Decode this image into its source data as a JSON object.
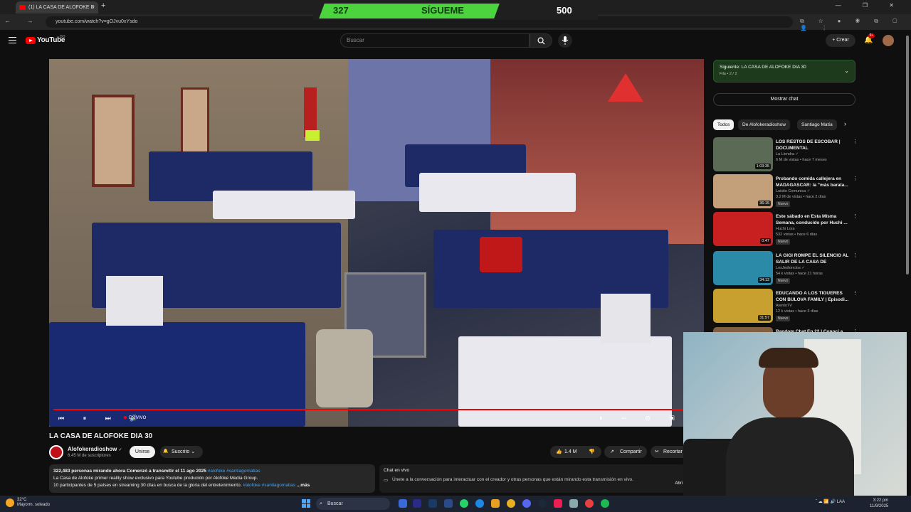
{
  "browser": {
    "tab_title": "(1) LA CASA DE ALOFOKE D",
    "url": "youtube.com/watch?v=gOJvu0xYsdo",
    "new_tab": "+",
    "window_controls": "— ❐ ✕",
    "nav": "← → ↻",
    "extensions": "⧉ ☆ ● ◉ ⧉ ▢ 👤 ⋮"
  },
  "overlay": {
    "left_number": "327",
    "center_text": "SÍGUEME",
    "right_number": "500",
    "accent_color": "#4cd43f"
  },
  "header": {
    "logo_text": "YouTube",
    "logo_sup": "DO",
    "search_placeholder": "Buscar",
    "create_label": "+ Crear",
    "notification_count": "9+"
  },
  "player": {
    "live_label": "EN VIVO",
    "left_controls": "⏮ ⏸ ⏭ 🔊",
    "right_controls": "⏸ ▭ ⚙ ▣ ⛶",
    "progress_fraction": 1.0
  },
  "video": {
    "title": "LA CASA DE ALOFOKE DIA 30",
    "channel": "Alofokeradioshow",
    "channel_verified": "✓",
    "subscribers": "6.45 M de suscriptores",
    "join_label": "Unirse",
    "subscribed_label": "Suscrito ⌄",
    "likes": "1.4 M",
    "share_label": "Compartir",
    "clip_label": "Recortar"
  },
  "description": {
    "line1_stats": "322,483 personas mirando ahora  Comenzó a transmitir el 11 ago 2025",
    "line1_tags": "#alofoke #santiagomatias",
    "line2": "La Casa de Alofoke primer reality show exclusivo para Youtube producido por Alofoke Media Group.",
    "line3": "10 participantes de 5 países en streaming 30 días en busca de la gloria del entretenimiento.",
    "line3_tags": "#alofoke #santiagomatias",
    "more": "...más"
  },
  "live_chat": {
    "title": "Chat en vivo",
    "prompt": "Únete a la conversación para interactuar con el creador y otras personas que están mirando esta transmisión en vivo.",
    "action": "Abri"
  },
  "sidebar": {
    "next_title": "Siguiente: LA CASA DE ALOFOKE DIA 30",
    "next_sub": "Fila • 2 / 2",
    "show_chat": "Mostrar chat",
    "chips": [
      "Todos",
      "De Alofokeradioshow",
      "Santiago Matía"
    ],
    "chips_next": "›",
    "recommendations": [
      {
        "title": "LOS RESTOS DE ESCOBAR | DOCUMENTAL",
        "channel": "La Liendra ✓",
        "meta": "6 M de vistas • hace 7 meses",
        "duration": "1:03:35",
        "badge": "",
        "thumb_color": "#5a6a55"
      },
      {
        "title": "Probando comida callejera en MADAGASCAR: la \"más barata...",
        "channel": "Luisito Comunica ✓",
        "meta": "3.2 M de vistas • hace 2 días",
        "duration": "36:15",
        "badge": "Nuevo",
        "thumb_color": "#c4a07a"
      },
      {
        "title": "Este sábado en Esta Mísma Semana, conducido por Huchi ...",
        "channel": "Huchi Lora",
        "meta": "532 vistas • hace 6 días",
        "duration": "0:47",
        "badge": "Nuevo",
        "thumb_color": "#c82020"
      },
      {
        "title": "LA GIGI ROMPE EL SILENCIO AL SALIR DE LA CASA DE ALOFOKE",
        "channel": "LosJedionclos ✓",
        "meta": "54 k vistas • hace 21 horas",
        "duration": "34:12",
        "badge": "Nuevo",
        "thumb_color": "#2a8aa8"
      },
      {
        "title": "EDUCANDO A LOS TIGUERES CON BULOVA FAMILY | Episodi...",
        "channel": "AtentoTV",
        "meta": "12 k vistas • hace 3 días",
        "duration": "31:57",
        "badge": "Nuevo",
        "thumb_color": "#c8a030"
      },
      {
        "title": "Random Chat Ep.22 | Conocí a",
        "channel": "",
        "meta": "",
        "duration": "",
        "badge": "",
        "thumb_color": "#806040"
      }
    ],
    "more_icon": "⋮"
  },
  "taskbar": {
    "weather_temp": "32°C",
    "weather_desc": "Mayorm. soleado",
    "search_label": "Buscar",
    "tray": "ˆ ☁ 📶 🔊 LAA",
    "time": "3:22 pm",
    "date": "11/9/2025"
  }
}
